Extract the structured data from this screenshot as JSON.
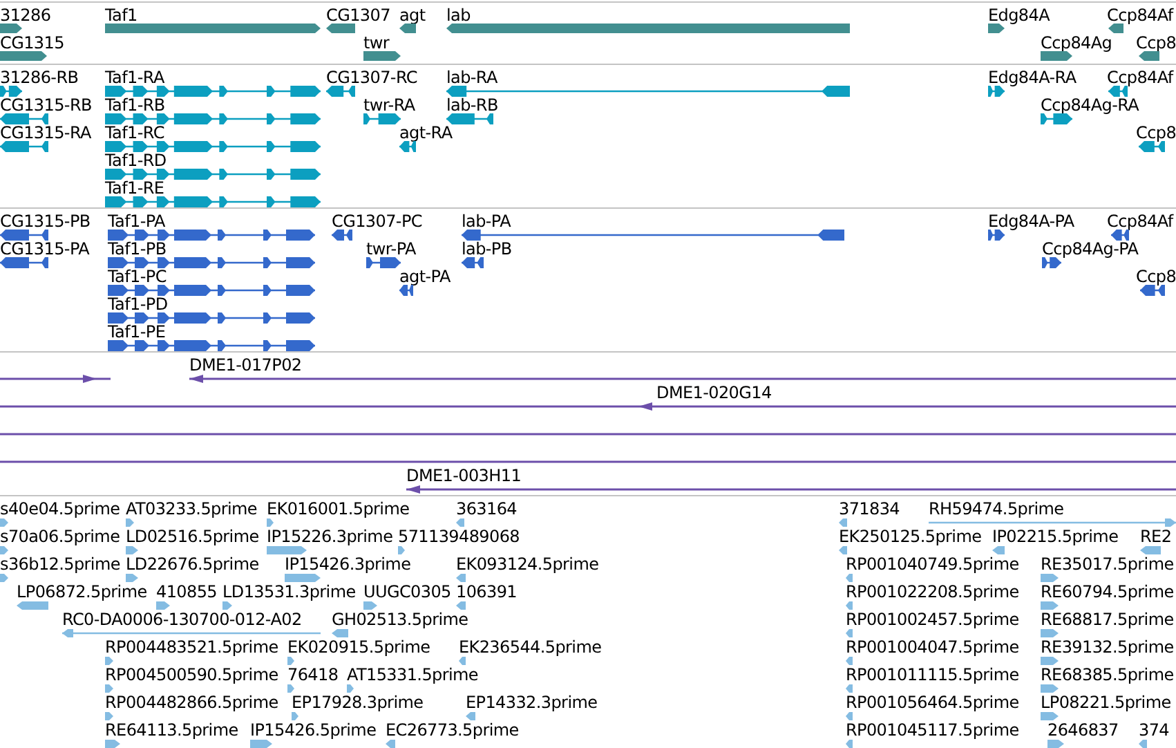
{
  "tracks": [
    {
      "kind": "gene",
      "color": "#428f90",
      "features": [
        {
          "label": "31286",
          "reverse": false
        },
        {
          "label": "Taf1",
          "reverse": false
        },
        {
          "label": "CG1307",
          "reverse": true
        },
        {
          "label": "agt",
          "reverse": true
        },
        {
          "label": "lab",
          "reverse": true
        },
        {
          "label": "Edg84A",
          "reverse": false
        },
        {
          "label": "Ccp84Af",
          "reverse": true
        },
        {
          "label": "CG1315",
          "reverse": false
        },
        {
          "label": "twr",
          "reverse": false
        },
        {
          "label": "Ccp84Ag",
          "reverse": false
        },
        {
          "label": "Ccp8",
          "reverse": true
        }
      ]
    },
    {
      "kind": "transcript",
      "color": "#0c9fc0",
      "features": [
        {
          "label": "31286-RB",
          "reverse": false
        },
        {
          "label": "Taf1-RA",
          "reverse": false
        },
        {
          "label": "CG1307-RC",
          "reverse": true
        },
        {
          "label": "lab-RA",
          "reverse": true
        },
        {
          "label": "Edg84A-RA",
          "reverse": false
        },
        {
          "label": "Ccp84Af",
          "reverse": true
        },
        {
          "label": "CG1315-RB",
          "reverse": true
        },
        {
          "label": "Taf1-RB",
          "reverse": false
        },
        {
          "label": "twr-RA",
          "reverse": false
        },
        {
          "label": "lab-RB",
          "reverse": true
        },
        {
          "label": "Ccp84Ag-RA",
          "reverse": false
        },
        {
          "label": "CG1315-RA",
          "reverse": true
        },
        {
          "label": "Taf1-RC",
          "reverse": false
        },
        {
          "label": "agt-RA",
          "reverse": true
        },
        {
          "label": "Ccp8",
          "reverse": true
        },
        {
          "label": "Taf1-RD",
          "reverse": false
        },
        {
          "label": "Taf1-RE",
          "reverse": false
        }
      ]
    },
    {
      "kind": "transcript",
      "color": "#3469cc",
      "features": [
        {
          "label": "CG1315-PB",
          "reverse": true
        },
        {
          "label": "Taf1-PA",
          "reverse": false
        },
        {
          "label": "CG1307-PC",
          "reverse": true
        },
        {
          "label": "lab-PA",
          "reverse": true
        },
        {
          "label": "Edg84A-PA",
          "reverse": false
        },
        {
          "label": "Ccp84Af",
          "reverse": true
        },
        {
          "label": "CG1315-PA",
          "reverse": true
        },
        {
          "label": "Taf1-PB",
          "reverse": false
        },
        {
          "label": "twr-PA",
          "reverse": false
        },
        {
          "label": "lab-PB",
          "reverse": true
        },
        {
          "label": "Ccp84Ag-PA",
          "reverse": false
        },
        {
          "label": "Taf1-PC",
          "reverse": false
        },
        {
          "label": "agt-PA",
          "reverse": true
        },
        {
          "label": "Ccp8",
          "reverse": true
        },
        {
          "label": "Taf1-PD",
          "reverse": false
        },
        {
          "label": "Taf1-PE",
          "reverse": false
        }
      ]
    },
    {
      "kind": "clone",
      "color": "#6c4faa",
      "features": [
        {
          "kind": "arrow",
          "reverse": false
        },
        {
          "kind": "arrow",
          "label": "DME1-017P02",
          "reverse": true
        },
        {
          "kind": "arrow",
          "label": "DME1-020G14",
          "reverse": true
        },
        {
          "kind": "line"
        },
        {
          "kind": "line"
        },
        {
          "kind": "arrow",
          "label": "DME1-003H11",
          "reverse": true
        }
      ]
    },
    {
      "kind": "est",
      "color": "#84bce2",
      "features": [
        {
          "label": "s40e04.5prime",
          "reverse": false
        },
        {
          "label": "AT03233.5prime",
          "reverse": false
        },
        {
          "label": "EK016001.5prime",
          "reverse": false
        },
        {
          "label": "363164",
          "reverse": true
        },
        {
          "label": "371834",
          "reverse": true
        },
        {
          "label": "RH59474.5prime",
          "reverse": false
        },
        {
          "label": "s70a06.5prime",
          "reverse": false
        },
        {
          "label": "LD02516.5prime",
          "reverse": false
        },
        {
          "label": "IP15226.3prime",
          "reverse": false
        },
        {
          "label": "571139489068",
          "reverse": false
        },
        {
          "label": "EK250125.5prime",
          "reverse": true
        },
        {
          "label": "IP02215.5prime",
          "reverse": true
        },
        {
          "label": "RE2",
          "reverse": true
        },
        {
          "label": "s36b12.5prime",
          "reverse": false
        },
        {
          "label": "LD22676.5prime",
          "reverse": false
        },
        {
          "label": "IP15426.3prime",
          "reverse": false
        },
        {
          "label": "EK093124.5prime",
          "reverse": true
        },
        {
          "label": "RP001040749.5prime",
          "reverse": true
        },
        {
          "label": "RE35017.5prime",
          "reverse": false
        },
        {
          "label": "LP06872.5prime",
          "reverse": true
        },
        {
          "label": "410855",
          "reverse": false
        },
        {
          "label": "LD13531.3prime",
          "reverse": false
        },
        {
          "label": "UUGC0305",
          "reverse": false
        },
        {
          "label": "106391",
          "reverse": true
        },
        {
          "label": "RP001022208.5prime",
          "reverse": true
        },
        {
          "label": "RE60794.5prime",
          "reverse": false
        },
        {
          "label": "RC0-DA0006-130700-012-A02",
          "reverse": true
        },
        {
          "label": "GH02513.5prime",
          "reverse": true
        },
        {
          "label": "RP001002457.5prime",
          "reverse": true
        },
        {
          "label": "RE68817.5prime",
          "reverse": false
        },
        {
          "label": "RP004483521.5prime",
          "reverse": false
        },
        {
          "label": "EK020915.5prime",
          "reverse": false
        },
        {
          "label": "EK236544.5prime",
          "reverse": true
        },
        {
          "label": "RP001004047.5prime",
          "reverse": true
        },
        {
          "label": "RE39132.5prime",
          "reverse": false
        },
        {
          "label": "RP004500590.5prime",
          "reverse": false
        },
        {
          "label": "76418",
          "reverse": false
        },
        {
          "label": "AT15331.5prime",
          "reverse": false
        },
        {
          "label": "RP001011115.5prime",
          "reverse": true
        },
        {
          "label": "RE68385.5prime",
          "reverse": false
        },
        {
          "label": "RP004482866.5prime",
          "reverse": false
        },
        {
          "label": "EP17928.3prime",
          "reverse": false
        },
        {
          "label": "EP14332.3prime",
          "reverse": true
        },
        {
          "label": "RP001056464.5prime",
          "reverse": true
        },
        {
          "label": "LP08221.5prime",
          "reverse": false
        },
        {
          "label": "RE64113.5prime",
          "reverse": false
        },
        {
          "label": "IP15426.5prime",
          "reverse": false
        },
        {
          "label": "EC26773.5prime",
          "reverse": true
        },
        {
          "label": "RP001045117.5prime",
          "reverse": true
        },
        {
          "label": "2646837",
          "reverse": false
        },
        {
          "label": "374",
          "reverse": true
        }
      ]
    }
  ]
}
